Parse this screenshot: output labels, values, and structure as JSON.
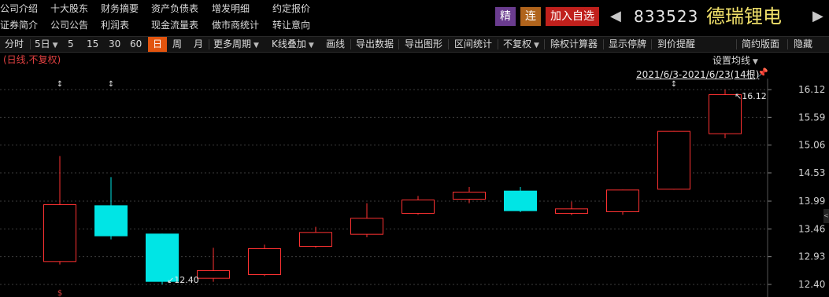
{
  "info_menu": [
    {
      "label": "公司介绍"
    },
    {
      "label": "十大股东"
    },
    {
      "label": "财务摘要"
    },
    {
      "label": "资产负债表"
    },
    {
      "label": "增发明细"
    },
    {
      "label": "约定报价"
    },
    {
      "label": "证券简介"
    },
    {
      "label": "公司公告"
    },
    {
      "label": "利润表"
    },
    {
      "label": "现金流量表"
    },
    {
      "label": "做市商统计"
    },
    {
      "label": "转让意向"
    }
  ],
  "header": {
    "jing_label": "精",
    "lian_label": "连",
    "add_watch_label": "加入自选",
    "prev_arrow": "◀",
    "next_arrow": "▶",
    "stock_code": "833523",
    "stock_name": "德瑞锂电",
    "colors": {
      "jing": "#6a3c8f",
      "lian": "#b0641c",
      "add": "#c0201c"
    }
  },
  "toolbar": {
    "items": [
      {
        "label": "分时"
      },
      {
        "label": "5日"
      },
      {
        "label": "5"
      },
      {
        "label": "15"
      },
      {
        "label": "30"
      },
      {
        "label": "60"
      },
      {
        "label": "日",
        "active": true
      },
      {
        "label": "周"
      },
      {
        "label": "月"
      },
      {
        "label": "更多周期"
      },
      {
        "label": "K线叠加"
      },
      {
        "label": "画线"
      },
      {
        "label": "导出数据"
      },
      {
        "label": "导出图形"
      },
      {
        "label": "区间统计"
      },
      {
        "label": "不复权"
      },
      {
        "label": "除权计算器"
      },
      {
        "label": "显示停牌"
      },
      {
        "label": "到价提醒"
      },
      {
        "label": "简约版面"
      },
      {
        "label": "隐藏"
      }
    ],
    "dropdown_icon": "▼"
  },
  "chart_meta": {
    "period_note": "(日线,不复权)",
    "set_ma_label": "设置均线",
    "range_label": "2021/6/3-2021/6/23(14根)",
    "pin_icon": "pin-icon",
    "side_collapse_icon": "<",
    "colors": {
      "up": "#ff3232",
      "down": "#00e5e5",
      "grid": "#3c3c3c",
      "axis_text": "#d0d0d0"
    }
  },
  "chart_data": {
    "type": "candlestick",
    "y_ticks": [
      "16.12",
      "15.59",
      "15.06",
      "14.53",
      "13.99",
      "13.46",
      "12.93",
      "12.40"
    ],
    "ylim": [
      12.4,
      16.12
    ],
    "candles": [
      {
        "open": 12.83,
        "close": 13.93,
        "high": 14.85,
        "low": 12.78,
        "dir": "up"
      },
      {
        "open": 13.91,
        "close": 13.32,
        "high": 14.45,
        "low": 13.26,
        "dir": "down"
      },
      {
        "open": 13.37,
        "close": 12.45,
        "high": 13.37,
        "low": 12.4,
        "dir": "down"
      },
      {
        "open": 12.51,
        "close": 12.67,
        "high": 13.1,
        "low": 12.45,
        "dir": "up"
      },
      {
        "open": 12.58,
        "close": 13.09,
        "high": 13.16,
        "low": 12.56,
        "dir": "up"
      },
      {
        "open": 13.12,
        "close": 13.4,
        "high": 13.5,
        "low": 13.1,
        "dir": "up"
      },
      {
        "open": 13.35,
        "close": 13.67,
        "high": 13.95,
        "low": 13.3,
        "dir": "up"
      },
      {
        "open": 13.75,
        "close": 14.02,
        "high": 14.09,
        "low": 13.73,
        "dir": "up"
      },
      {
        "open": 14.02,
        "close": 14.17,
        "high": 14.26,
        "low": 13.95,
        "dir": "up"
      },
      {
        "open": 14.19,
        "close": 13.8,
        "high": 14.26,
        "low": 13.78,
        "dir": "down"
      },
      {
        "open": 13.75,
        "close": 13.85,
        "high": 13.98,
        "low": 13.72,
        "dir": "up"
      },
      {
        "open": 13.78,
        "close": 14.21,
        "high": 14.21,
        "low": 13.73,
        "dir": "up"
      },
      {
        "open": 14.21,
        "close": 15.33,
        "high": 15.33,
        "low": 14.21,
        "dir": "up"
      },
      {
        "open": 15.27,
        "close": 16.03,
        "high": 16.12,
        "low": 15.19,
        "dir": "up"
      }
    ],
    "annotations": {
      "high_label": "16.12",
      "low_label": "12.40",
      "high_index": 13,
      "low_index": 2
    }
  }
}
